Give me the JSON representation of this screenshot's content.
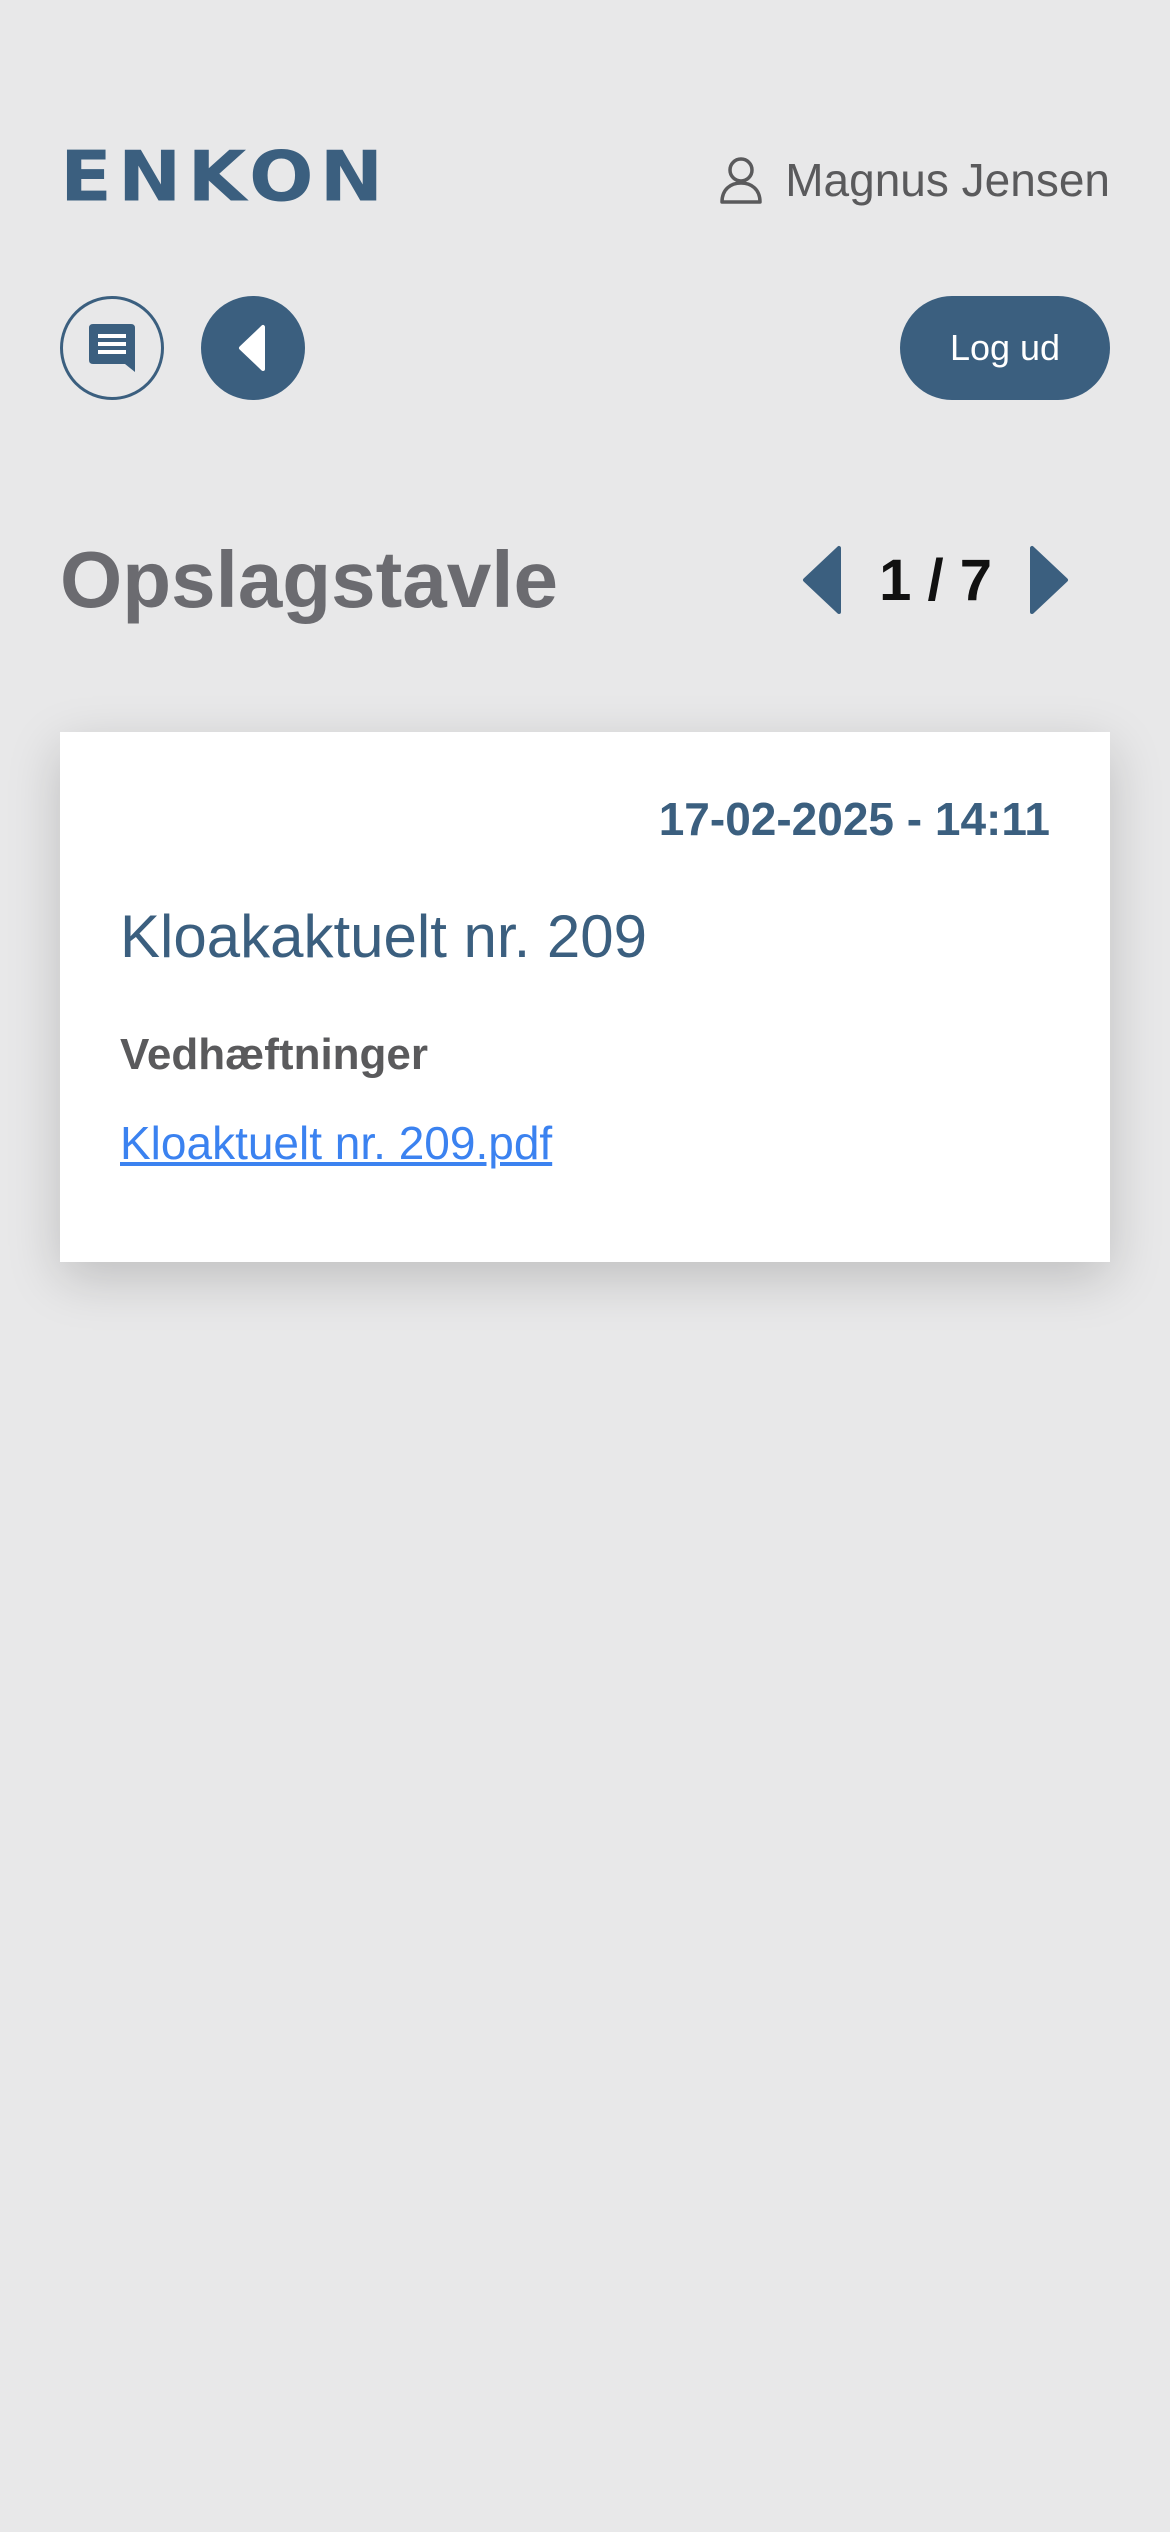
{
  "header": {
    "logo_text": "ENKON",
    "user_icon": "user-icon",
    "user_name": "Magnus Jensen"
  },
  "toolbar": {
    "chat_icon": "chat-bubble-icon",
    "back_icon": "back-arrow-icon",
    "logout_label": "Log ud"
  },
  "page": {
    "title": "Opslagstavle",
    "pager": {
      "prev_icon": "chevron-left-icon",
      "count": "1 / 7",
      "next_icon": "chevron-right-icon"
    }
  },
  "post": {
    "date": "17-02-2025 - 14:11",
    "title": "Kloakaktuelt nr. 209",
    "attachments_label": "Vedhæftninger",
    "attachments": [
      {
        "name": "Kloaktuelt nr. 209.pdf"
      }
    ]
  },
  "colors": {
    "background": "#e8e8e9",
    "primary": "#3b5f7f",
    "link": "#3b82f0",
    "card": "#ffffff"
  }
}
